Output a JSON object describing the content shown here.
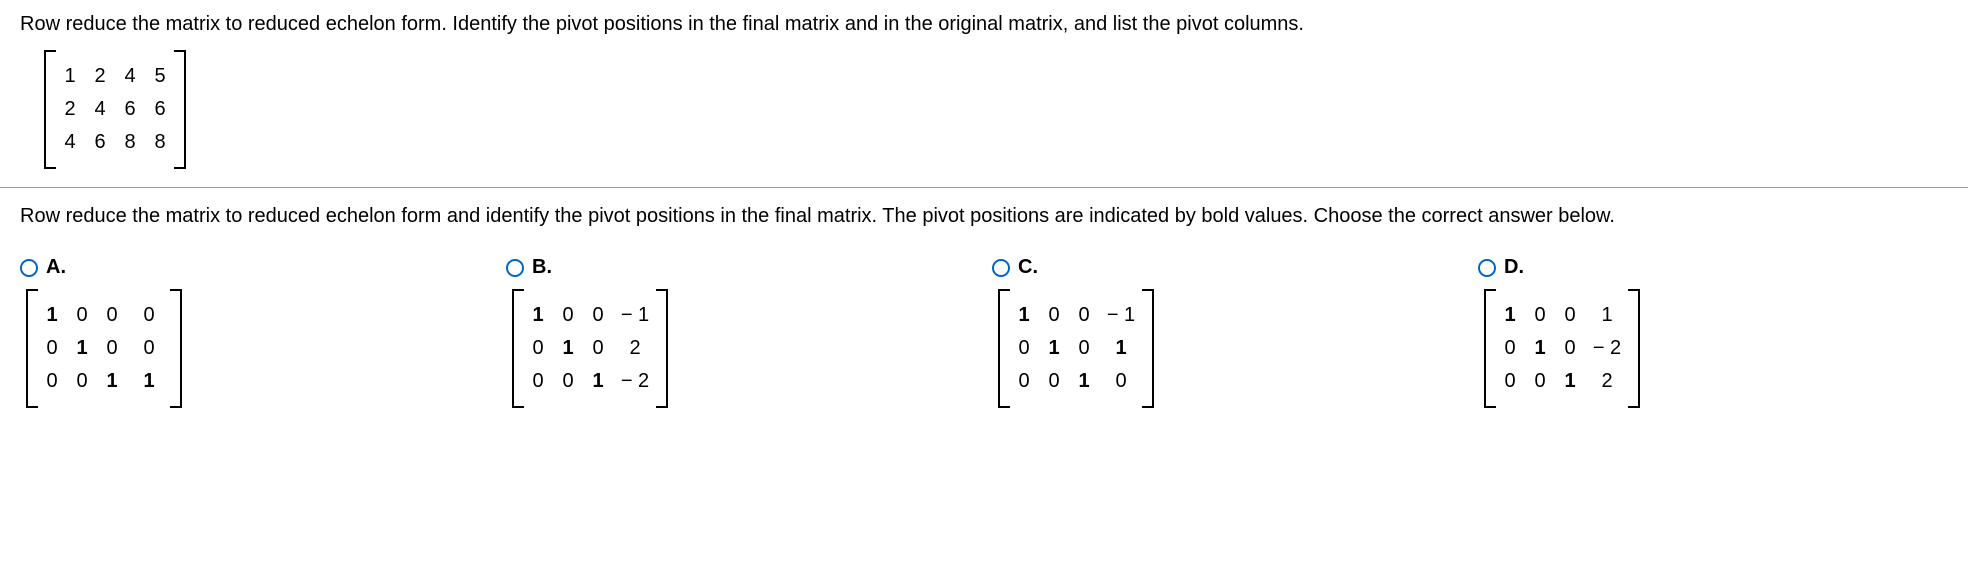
{
  "question_text": "Row reduce the matrix to reduced echelon form. Identify the pivot positions in the final matrix and in the original matrix, and list the pivot columns.",
  "matrix": {
    "rows": [
      [
        "1",
        "2",
        "4",
        "5"
      ],
      [
        "2",
        "4",
        "6",
        "6"
      ],
      [
        "4",
        "6",
        "8",
        "8"
      ]
    ]
  },
  "sub_question": "Row reduce the matrix to reduced echelon form and identify the pivot positions in the final matrix. The pivot positions are indicated by bold values. Choose the correct answer below.",
  "options": {
    "A": {
      "label": "A.",
      "rows": [
        [
          {
            "v": "1",
            "b": true
          },
          {
            "v": "0"
          },
          {
            "v": "0"
          },
          {
            "v": "0"
          }
        ],
        [
          {
            "v": "0"
          },
          {
            "v": "1",
            "b": true
          },
          {
            "v": "0"
          },
          {
            "v": "0"
          }
        ],
        [
          {
            "v": "0"
          },
          {
            "v": "0"
          },
          {
            "v": "1",
            "b": true
          },
          {
            "v": "1",
            "b": true
          }
        ]
      ]
    },
    "B": {
      "label": "B.",
      "rows": [
        [
          {
            "v": "1",
            "b": true
          },
          {
            "v": "0"
          },
          {
            "v": "0"
          },
          {
            "v": "− 1"
          }
        ],
        [
          {
            "v": "0"
          },
          {
            "v": "1",
            "b": true
          },
          {
            "v": "0"
          },
          {
            "v": "2"
          }
        ],
        [
          {
            "v": "0"
          },
          {
            "v": "0"
          },
          {
            "v": "1",
            "b": true
          },
          {
            "v": "− 2"
          }
        ]
      ]
    },
    "C": {
      "label": "C.",
      "rows": [
        [
          {
            "v": "1",
            "b": true
          },
          {
            "v": "0"
          },
          {
            "v": "0"
          },
          {
            "v": "− 1"
          }
        ],
        [
          {
            "v": "0"
          },
          {
            "v": "1",
            "b": true
          },
          {
            "v": "0"
          },
          {
            "v": "1",
            "b": true
          }
        ],
        [
          {
            "v": "0"
          },
          {
            "v": "0"
          },
          {
            "v": "1",
            "b": true
          },
          {
            "v": "0"
          }
        ]
      ]
    },
    "D": {
      "label": "D.",
      "rows": [
        [
          {
            "v": "1",
            "b": true
          },
          {
            "v": "0"
          },
          {
            "v": "0"
          },
          {
            "v": "1"
          }
        ],
        [
          {
            "v": "0"
          },
          {
            "v": "1",
            "b": true
          },
          {
            "v": "0"
          },
          {
            "v": "− 2"
          }
        ],
        [
          {
            "v": "0"
          },
          {
            "v": "0"
          },
          {
            "v": "1",
            "b": true
          },
          {
            "v": "2"
          }
        ]
      ]
    }
  }
}
